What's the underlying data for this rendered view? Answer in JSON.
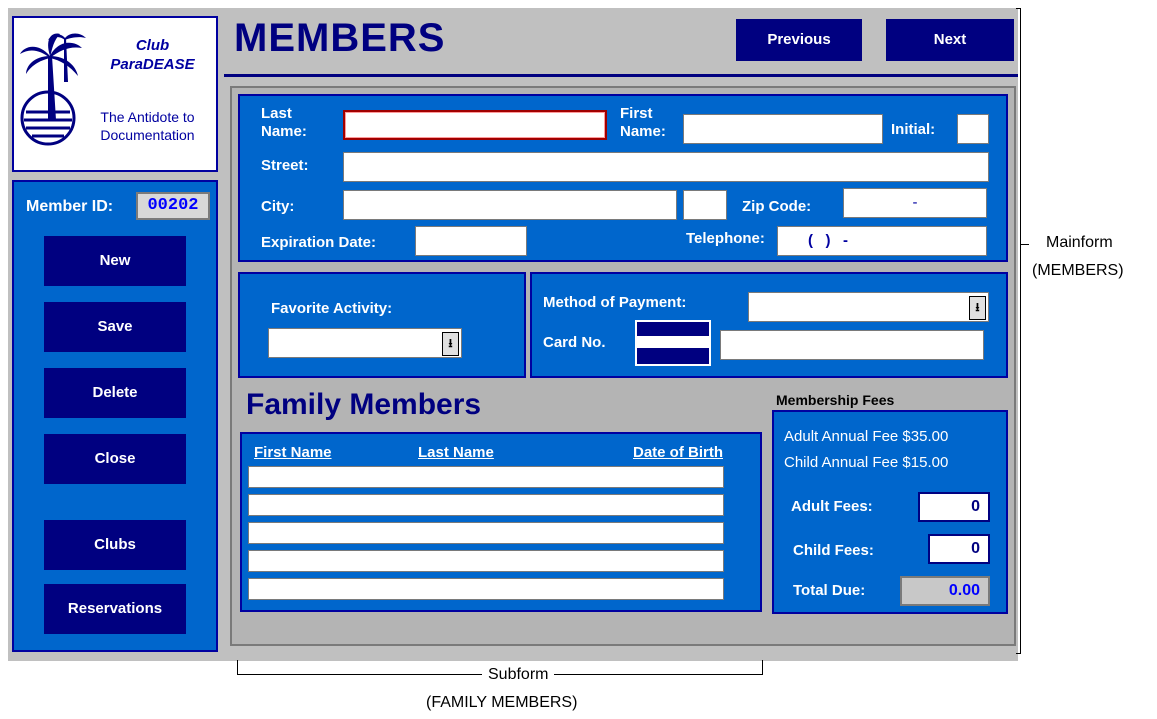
{
  "window": {
    "title": "MEMBERS",
    "prev_label": "Previous",
    "next_label": "Next"
  },
  "logo": {
    "name_line1": "Club",
    "name_line2": "ParaDEASE",
    "tagline_line1": "The Antidote to",
    "tagline_line2": "Documentation"
  },
  "sidebar": {
    "member_id_label": "Member ID:",
    "member_id_value": "00202",
    "buttons": [
      "New",
      "Save",
      "Delete",
      "Close",
      "Clubs",
      "Reservations"
    ]
  },
  "form": {
    "last_name_label_1": "Last",
    "last_name_label_2": "Name:",
    "first_name_label_1": "First",
    "first_name_label_2": "Name:",
    "initial_label": "Initial:",
    "street_label": "Street:",
    "city_label": "City:",
    "zip_label": "Zip Code:",
    "zip_value": "-",
    "expiration_label": "Expiration Date:",
    "telephone_label": "Telephone:",
    "telephone_value": "(   )   -",
    "favorite_activity_label": "Favorite Activity:",
    "method_payment_label": "Method of Payment:",
    "card_no_label": "Card No."
  },
  "family": {
    "title": "Family Members",
    "columns": [
      "First Name",
      "Last Name",
      "Date of Birth"
    ],
    "rows": 5
  },
  "fees": {
    "title": "Membership Fees",
    "adult_annual": "Adult Annual Fee $35.00",
    "child_annual": "Child Annual Fee $15.00",
    "adult_label": "Adult Fees:",
    "adult_value": "0",
    "child_label": "Child Fees:",
    "child_value": "0",
    "total_label": "Total Due:",
    "total_value": "0.00"
  },
  "annotations": {
    "mainform_1": "Mainform",
    "mainform_2": "(MEMBERS)",
    "subform_1": "Subform",
    "subform_2": "(FAMILY MEMBERS)"
  },
  "colors": {
    "panel_blue": "#0066cc",
    "navy": "#000080",
    "frame_gray": "#c0c0c0"
  }
}
